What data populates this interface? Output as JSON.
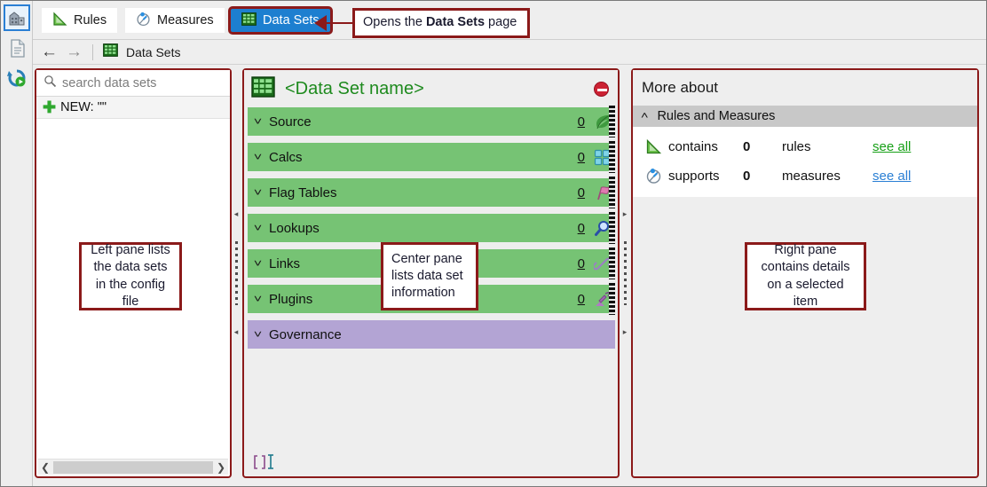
{
  "window": {
    "rail_icons": [
      {
        "name": "building-icon",
        "selected": true
      },
      {
        "name": "document-icon",
        "selected": false
      },
      {
        "name": "refresh-history-icon",
        "selected": false
      }
    ]
  },
  "tabs": [
    {
      "label": "Rules",
      "icon": "set-square-icon",
      "selected": false
    },
    {
      "label": "Measures",
      "icon": "gauge-icon",
      "selected": false
    },
    {
      "label": "Data Sets",
      "icon": "grid-table-icon",
      "selected": true
    }
  ],
  "breadcrumb": {
    "back_icon": "arrow-left-icon",
    "forward_icon": "arrow-right-icon",
    "icon": "grid-table-icon",
    "label": "Data Sets"
  },
  "left_pane": {
    "search_placeholder": "search data sets",
    "search_icon": "magnifier-icon",
    "new_item": "NEW: \"\"",
    "scroll_left_icon": "chevron-left-icon",
    "scroll_right_icon": "chevron-right-icon"
  },
  "center_pane": {
    "title": "<Data Set name>",
    "title_icon": "grid-table-icon",
    "delete_icon": "no-entry-icon",
    "expander_icon": "double-chevron-down-icon",
    "footer_icon": "brackets-text-cursor-icon",
    "rows": [
      {
        "label": "Source",
        "count": "0",
        "icon": "leaf-icon",
        "color": "#76c374"
      },
      {
        "label": "Calcs",
        "count": "0",
        "icon": "squares-icon",
        "color": "#76c374"
      },
      {
        "label": "Flag Tables",
        "count": "0",
        "icon": "flag-icon",
        "color": "#76c374"
      },
      {
        "label": "Lookups",
        "count": "0",
        "icon": "magnifier-icon",
        "color": "#76c374"
      },
      {
        "label": "Links",
        "count": "0",
        "icon": "chain-link-icon",
        "color": "#76c374"
      },
      {
        "label": "Plugins",
        "count": "0",
        "icon": "plug-icon",
        "color": "#76c374"
      },
      {
        "label": "Governance",
        "count": "",
        "icon": "",
        "color": "#b3a4d4"
      }
    ]
  },
  "right_pane": {
    "heading": "More about",
    "section_title": "Rules and Measures",
    "collapse_icon": "double-chevron-up-icon",
    "details": [
      {
        "icon": "set-square-icon",
        "verb": "contains",
        "count": "0",
        "noun": "rules",
        "link": "see all",
        "link_color": "#18a018"
      },
      {
        "icon": "gauge-icon",
        "verb": "supports",
        "count": "0",
        "noun": "measures",
        "link": "see all",
        "link_color": "#2a7fd4"
      }
    ]
  },
  "callouts": {
    "tab_prefix": "Opens the ",
    "tab_bold": "Data Sets",
    "tab_suffix": " page",
    "left": "Left pane lists the data sets in the config file",
    "center": "Center pane lists data set information",
    "right": "Right pane contains details on a selected item"
  },
  "colors": {
    "annotation": "#8b1a1a",
    "row_green": "#76c374",
    "row_purple": "#b3a4d4",
    "tab_selected": "#1d7fd0",
    "title_green": "#1e8a1e"
  }
}
